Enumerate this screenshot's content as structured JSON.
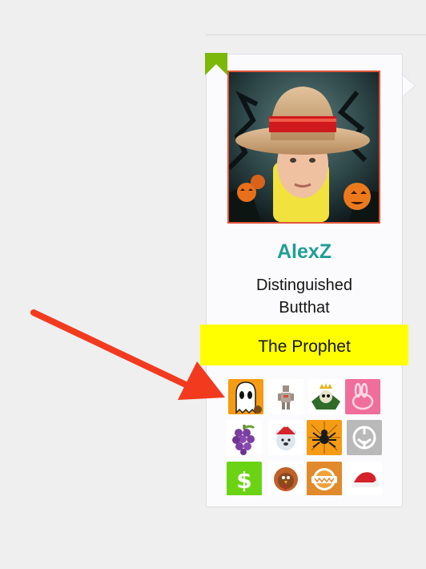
{
  "profile": {
    "username": "AlexZ",
    "title_lines": [
      "Distinguished",
      "Butthat"
    ],
    "banner": "The Prophet",
    "accent_color": "#1f9e95",
    "banner_color": "#ffff00",
    "corner_flag_color": "#7cb80a",
    "avatar_border_color": "#e0553a"
  },
  "trophies": [
    {
      "icon": "ghost-icon",
      "bg": "#f59b14"
    },
    {
      "icon": "robot-figure-icon",
      "bg": "#ffffff"
    },
    {
      "icon": "crowned-skull-icon",
      "bg": "#ffffff"
    },
    {
      "icon": "pink-rabbit-icon",
      "bg": "#f06e9b"
    },
    {
      "icon": "grapes-icon",
      "bg": "#ffffff"
    },
    {
      "icon": "santa-bear-icon",
      "bg": "#ffffff"
    },
    {
      "icon": "spider-icon",
      "bg": "#f59b14"
    },
    {
      "icon": "rebel-alliance-icon",
      "bg": "#b9b9b9"
    },
    {
      "icon": "dollar-icon",
      "bg": "#6ad414"
    },
    {
      "icon": "turkey-icon",
      "bg": "#ffffff"
    },
    {
      "icon": "globe-badge-icon",
      "bg": "#e08a2c"
    },
    {
      "icon": "santa-hat-icon",
      "bg": "#ffffff"
    }
  ],
  "annotation": {
    "icon": "arrow-icon",
    "color": "#f23a1e"
  }
}
